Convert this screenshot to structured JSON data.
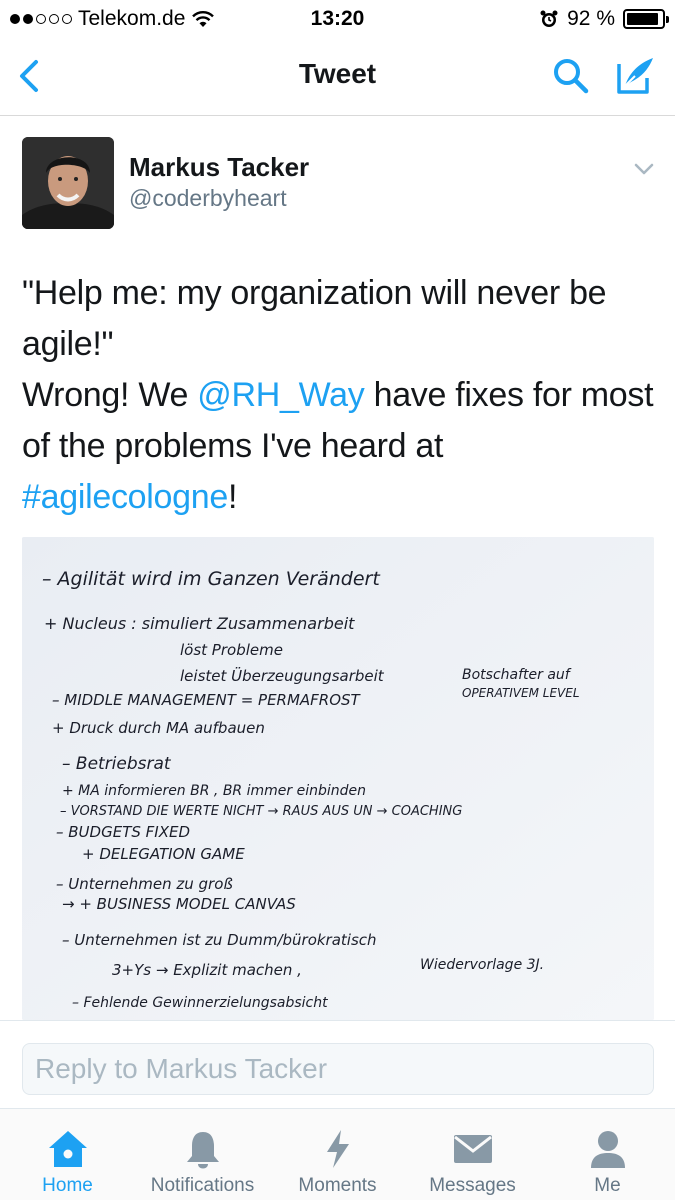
{
  "status_bar": {
    "carrier": "Telekom.de",
    "time": "13:20",
    "battery": "92 %",
    "battery_level": 0.92
  },
  "nav": {
    "title": "Tweet"
  },
  "tweet": {
    "author_name": "Markus Tacker",
    "author_handle": "@coderbyheart",
    "text_part1": "\"Help me: my organization will never be agile!\"",
    "text_part2": "Wrong! We ",
    "mention": "@RH_Way",
    "text_part3": " have fixes for most of the problems I've heard at ",
    "hashtag": "#agilecologne",
    "text_part4": "!"
  },
  "media": {
    "lines": [
      "– Agilität wird im Ganzen Verändert",
      "+ Nucleus : simuliert Zusammenarbeit",
      "löst Probleme",
      "leistet Überzeugungsarbeit",
      "Botschafter auf",
      "OPERATIVEM LEVEL",
      "– MIDDLE MANAGEMENT = PERMAFROST",
      "+ Druck durch MA aufbauen",
      "– Betriebsrat",
      "+ MA informieren BR , BR immer einbinden",
      "– VORSTAND DIE WERTE NICHT → RAUS AUS UN → COACHING",
      "– BUDGETS FIXED",
      "+ DELEGATION GAME",
      "– Unternehmen zu groß",
      "→ + BUSINESS MODEL CANVAS",
      "– Unternehmen ist zu Dumm/bürokratisch",
      "3+Ys → Explizit machen ,",
      "Wiedervorlage 3J.",
      "– Fehlende Gewinnerzielungsabsicht"
    ]
  },
  "reply": {
    "placeholder": "Reply to Markus Tacker"
  },
  "tabs": [
    {
      "label": "Home",
      "icon": "home-icon",
      "active": true
    },
    {
      "label": "Notifications",
      "icon": "bell-icon",
      "active": false
    },
    {
      "label": "Moments",
      "icon": "lightning-icon",
      "active": false
    },
    {
      "label": "Messages",
      "icon": "envelope-icon",
      "active": false
    },
    {
      "label": "Me",
      "icon": "person-icon",
      "active": false
    }
  ],
  "colors": {
    "accent": "#1da1f2",
    "text": "#14171a",
    "secondary": "#657786",
    "icon_inactive": "#8899a6"
  }
}
